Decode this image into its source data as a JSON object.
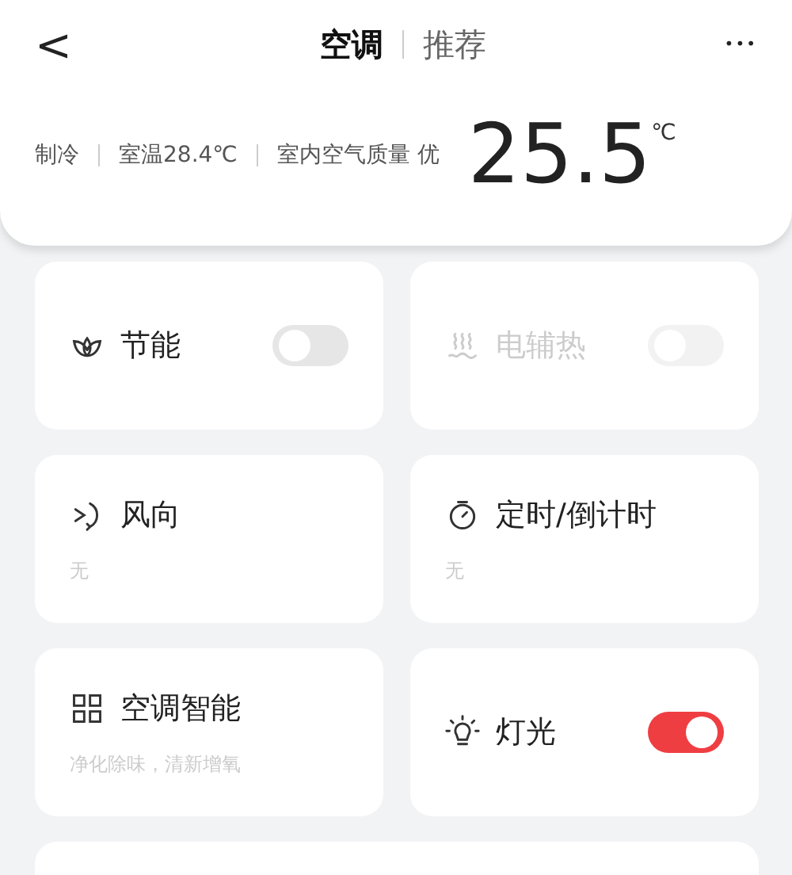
{
  "nav": {
    "back": "<",
    "more": "•••",
    "tabs": [
      {
        "label": "空调",
        "selected": true
      },
      {
        "label": "推荐",
        "selected": false
      }
    ]
  },
  "status": {
    "items": [
      "制冷",
      "室温28.4℃",
      "室内空气质量 优"
    ],
    "temperature": "25.5",
    "unit": "℃"
  },
  "cards": [
    {
      "kind": "toggle",
      "label": "节能",
      "on": false,
      "disabled": false
    },
    {
      "kind": "toggle",
      "label": "电辅热",
      "on": false,
      "disabled": true
    },
    {
      "kind": "info",
      "label": "风向",
      "subtitle": "无"
    },
    {
      "kind": "info",
      "label": "定时/倒计时",
      "subtitle": "无"
    },
    {
      "kind": "info",
      "label": "空调智能",
      "subtitle": "净化除味，清新增氧"
    },
    {
      "kind": "toggle",
      "label": "灯光",
      "on": true,
      "disabled": false
    }
  ]
}
